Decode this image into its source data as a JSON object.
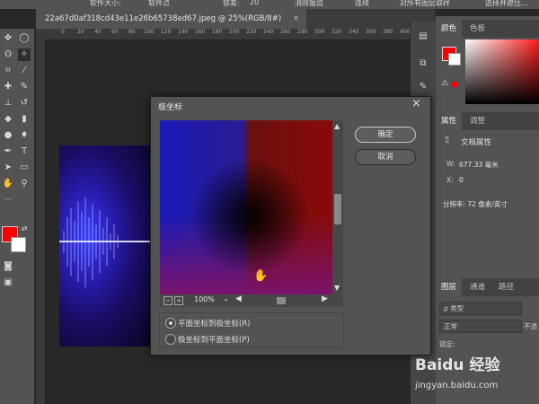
{
  "optbar": {
    "texts": [
      "软件大小:",
      "软件点",
      "容差:",
      "20",
      "消除锯齿",
      "连续",
      "对所有图层取样",
      "选择并遮住..."
    ]
  },
  "document": {
    "tab_title": "22a67d0af318cd43e11e26b65738ed67.jpeg @ 25%(RGB/8#)",
    "close": "×"
  },
  "ruler": {
    "ticks": [
      "0",
      "20",
      "40",
      "60",
      "80",
      "100",
      "120",
      "140",
      "160",
      "180",
      "200",
      "220",
      "240",
      "260",
      "280",
      "300",
      "320",
      "340",
      "360",
      "380",
      "400",
      "420",
      "440"
    ]
  },
  "right_panel": {
    "color_tabs": [
      "颜色",
      "色板"
    ],
    "props_tabs": [
      "属性",
      "调整"
    ],
    "doc_props": "文档属性",
    "w_label": "W:",
    "w_value": "677.33 毫米",
    "x_label": "X:",
    "x_value": "0",
    "resolution": "分辨率: 72 像素/英寸",
    "layers_tabs": [
      "图层",
      "通道",
      "路径"
    ],
    "kind_placeholder": "ρ 类型",
    "blend_mode": "正常",
    "opacity_short": "不透",
    "lock_label": "锁定:"
  },
  "dialog": {
    "title": "极坐标",
    "close": "×",
    "ok_label": "确定",
    "cancel_label": "取消",
    "zoom_minus": "−",
    "zoom_plus": "+",
    "zoom_value": "100%",
    "option1": "平面坐标到极坐标(R)",
    "option2": "极坐标到平面坐标(P)",
    "selected_option": 1
  },
  "watermark": {
    "brand": "Baidu 经验",
    "url": "jingyan.baidu.com"
  },
  "colors": {
    "foreground": "#ff0000",
    "background": "#ffffff",
    "panel": "#535353",
    "app_bg": "#282828"
  }
}
